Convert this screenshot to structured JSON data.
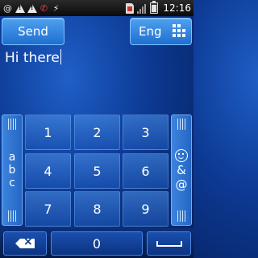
{
  "status_bar": {
    "time": "12:16",
    "left_icons": [
      "at-icon",
      "warning-icon",
      "warning-icon",
      "missed-call-icon",
      "usb-icon"
    ],
    "right_icons": [
      "sim-icon",
      "signal-icon",
      "battery-icon"
    ]
  },
  "toolbar": {
    "send_label": "Send",
    "language_label": "Eng"
  },
  "message": {
    "text": "Hi there"
  },
  "keypad": {
    "left_panel_letters": [
      "a",
      "b",
      "c"
    ],
    "right_panel_symbols": [
      "&",
      "@"
    ],
    "keys": [
      "1",
      "2",
      "3",
      "4",
      "5",
      "6",
      "7",
      "8",
      "9"
    ],
    "zero": "0"
  },
  "colors": {
    "accent": "#2f7fe0",
    "background": "#0d3a94"
  }
}
